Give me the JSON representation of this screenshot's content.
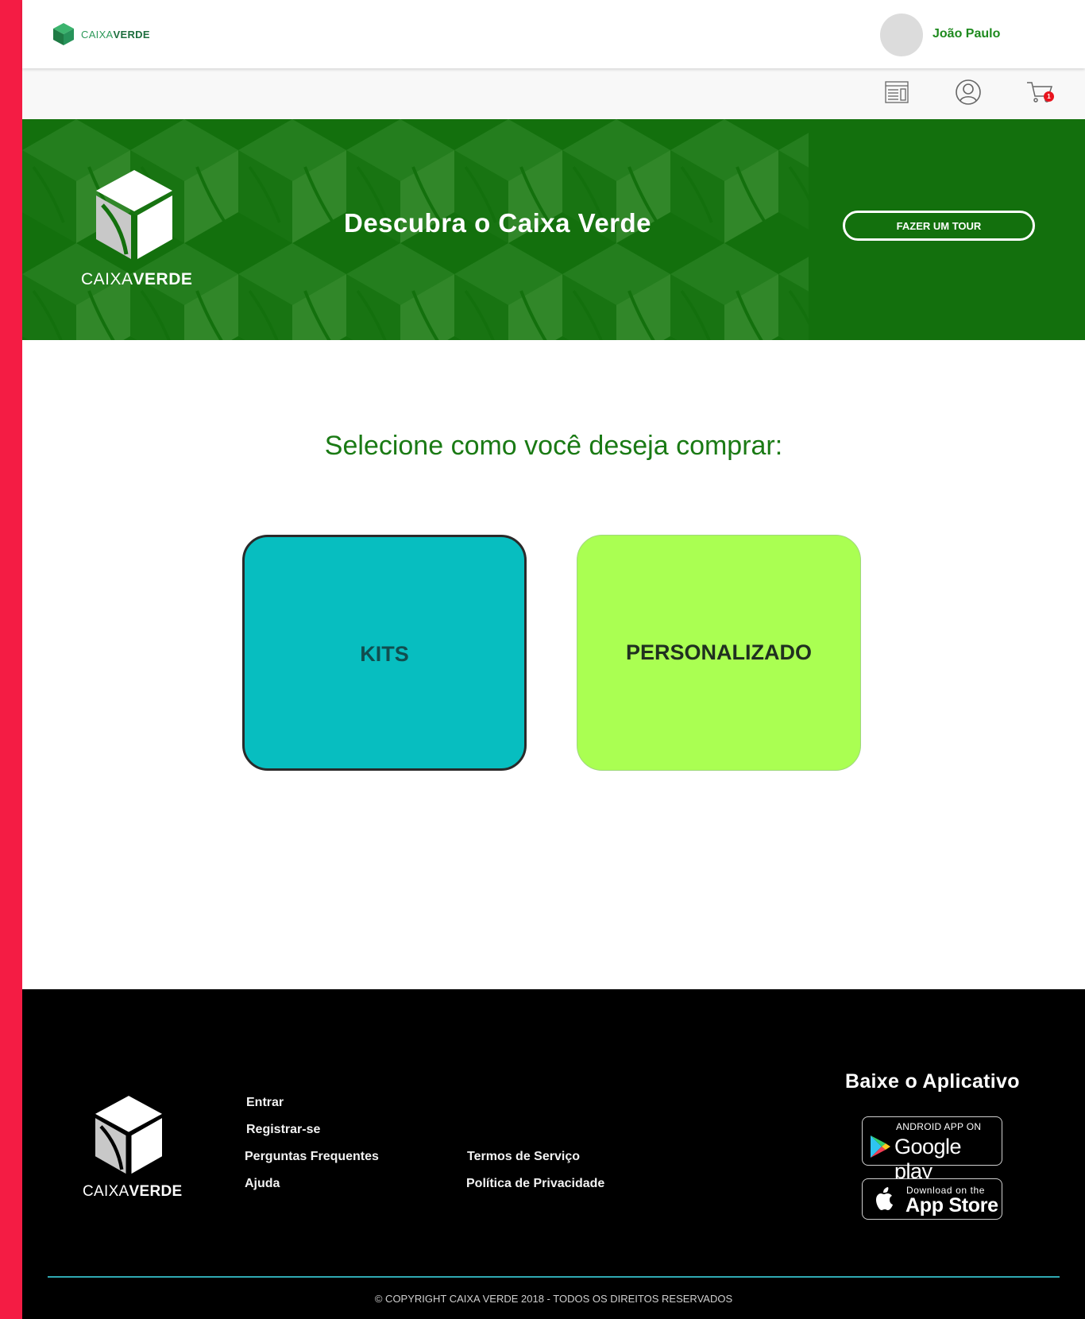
{
  "header": {
    "brand_light": "CAIXA",
    "brand_bold": "VERDE",
    "user_name": "João Paulo",
    "cart_count": "1",
    "icons": [
      "news-icon",
      "user-profile-icon",
      "cart-icon"
    ]
  },
  "hero": {
    "logo_light": "CAIXA",
    "logo_bold": "VERDE",
    "title": "Descubra o Caixa Verde",
    "tour_button": "FAZER UM TOUR"
  },
  "main": {
    "prompt": "Selecione como você deseja comprar:",
    "options": [
      {
        "label": "KITS",
        "color": "#07bec0"
      },
      {
        "label": "PERSONALIZADO",
        "color": "#aaff52"
      }
    ]
  },
  "footer": {
    "logo_light": "CAIXA",
    "logo_bold": "VERDE",
    "links_col1": [
      "Entrar",
      "Registrar-se",
      "Perguntas Frequentes",
      "Ajuda"
    ],
    "links_col2": [
      "Termos de Serviço",
      "Política de Privacidade"
    ],
    "app_title": "Baixe o Aplicativo",
    "google_play_small": "ANDROID APP ON",
    "google_play_big": "Google play",
    "app_store_small": "Download on the",
    "app_store_big": "App Store",
    "copyright": "© COPYRIGHT CAIXA VERDE 2018 - TODOS OS DIREITOS RESERVADOS"
  },
  "colors": {
    "side_bar": "#f41c44",
    "brand_green": "#13700d",
    "footer_line": "#2fa9b2"
  }
}
